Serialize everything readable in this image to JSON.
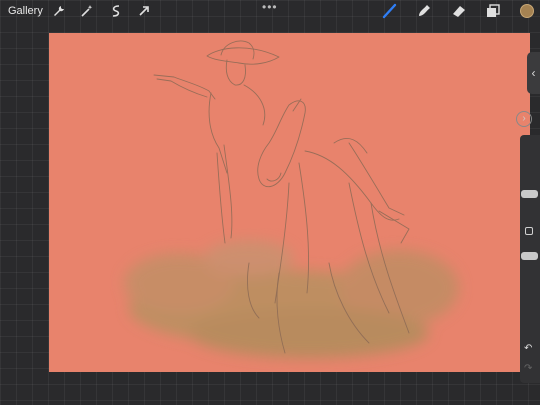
{
  "topbar": {
    "gallery_label": "Gallery",
    "tools_left": [
      "wrench-icon",
      "magic-wand-icon",
      "selection-icon",
      "transform-arrow-icon"
    ],
    "tools_right": [
      "brush-icon",
      "smudge-icon",
      "eraser-icon",
      "layers-icon"
    ],
    "active_tool": "brush-icon",
    "active_color": "#a58252",
    "accent_color": "#2f7ef5"
  },
  "canvas": {
    "background_color": "#e8836c",
    "content": "sketch-cowboy-on-horse-with-dust-cloud"
  },
  "sidebar": {
    "collapse_icon": "chevron-left-icon",
    "quickmenu_icon": "chevron-right-icon",
    "undo_icon": "undo-icon",
    "redo_icon": "redo-icon",
    "brush_size_level": 0.75,
    "brush_opacity_level": 0.5
  }
}
